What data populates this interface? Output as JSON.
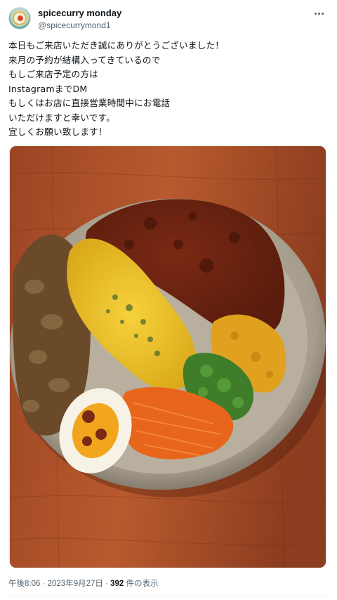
{
  "author": {
    "display_name": "spicecurry monday",
    "handle": "@spicecurrymond1"
  },
  "tweet": {
    "lines": [
      "本日もご来店いただき誠にありがとうございました！",
      "来月の予約が結構入ってきているので",
      "もしご来店予定の方は",
      "InstagramまでDM",
      "もしくはお店に直接営業時間中にお電話",
      "いただけますと幸いです。",
      "宜しくお願い致します！"
    ]
  },
  "media": {
    "icon": "curry-plate-photo"
  },
  "meta": {
    "time": "午後8:06",
    "separator_1": " · ",
    "date": "2023年9月27日",
    "separator_2": " · ",
    "views_count": "392",
    "views_label": " 件の表示"
  },
  "colors": {
    "text_primary": "#0f1419",
    "text_secondary": "#536471",
    "divider": "#eff3f4"
  }
}
